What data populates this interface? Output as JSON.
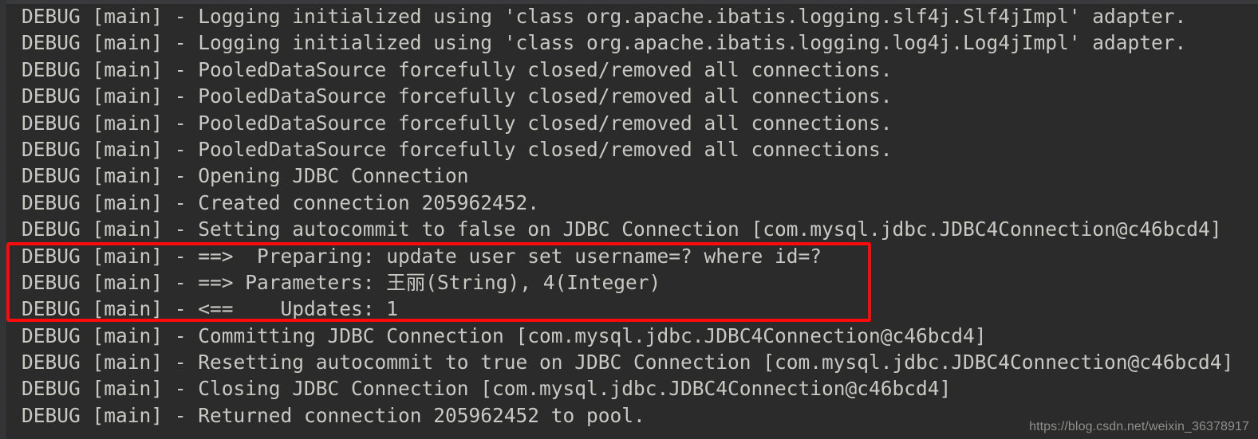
{
  "window": {
    "title": "Console Log Output",
    "background_color": "#2b2b2b",
    "text_color": "#c9c9c4",
    "gutter_color": "#313335"
  },
  "console": {
    "lines": [
      "DEBUG [main] - Logging initialized using 'class org.apache.ibatis.logging.slf4j.Slf4jImpl' adapter.",
      "DEBUG [main] - Logging initialized using 'class org.apache.ibatis.logging.log4j.Log4jImpl' adapter.",
      "DEBUG [main] - PooledDataSource forcefully closed/removed all connections.",
      "DEBUG [main] - PooledDataSource forcefully closed/removed all connections.",
      "DEBUG [main] - PooledDataSource forcefully closed/removed all connections.",
      "DEBUG [main] - PooledDataSource forcefully closed/removed all connections.",
      "DEBUG [main] - Opening JDBC Connection",
      "DEBUG [main] - Created connection 205962452.",
      "DEBUG [main] - Setting autocommit to false on JDBC Connection [com.mysql.jdbc.JDBC4Connection@c46bcd4]",
      "DEBUG [main] - ==>  Preparing: update user set username=? where id=?",
      "DEBUG [main] - ==> Parameters: 王丽(String), 4(Integer)",
      "DEBUG [main] - <==    Updates: 1",
      "DEBUG [main] - Committing JDBC Connection [com.mysql.jdbc.JDBC4Connection@c46bcd4]",
      "DEBUG [main] - Resetting autocommit to true on JDBC Connection [com.mysql.jdbc.JDBC4Connection@c46bcd4]",
      "DEBUG [main] - Closing JDBC Connection [com.mysql.jdbc.JDBC4Connection@c46bcd4]",
      "DEBUG [main] - Returned connection 205962452 to pool."
    ]
  },
  "annotation": {
    "highlight": {
      "color": "#fb0b0b",
      "first_line_index": 9,
      "last_line_index": 11,
      "label": "sql-execution-highlight"
    }
  },
  "watermark": {
    "text": "https://blog.csdn.net/weixin_36378917",
    "color": "#8f8f8c"
  }
}
